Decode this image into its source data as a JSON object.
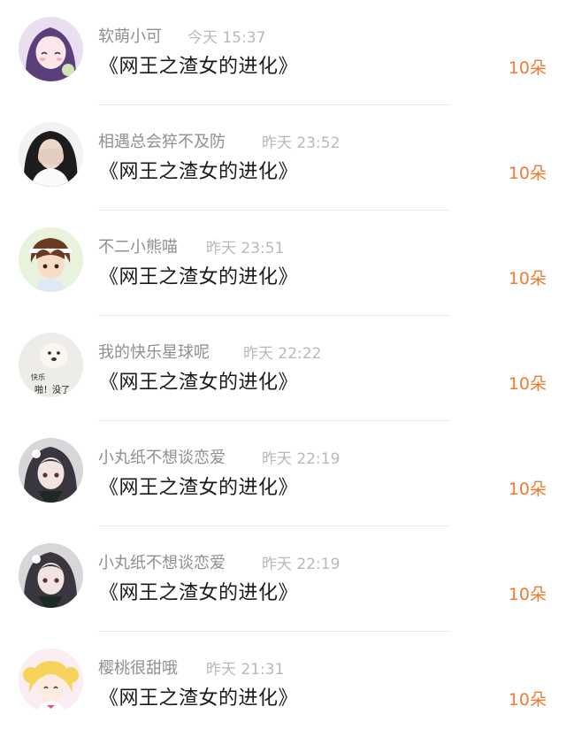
{
  "gifts": [
    {
      "user": "软萌小可",
      "time": "今天 15:37",
      "book": "《网王之渣女的进化》",
      "amount": "10朵",
      "avatar_icon": "anime-girl-purple-hair"
    },
    {
      "user": "相遇总会猝不及防",
      "time": "昨天 23:52",
      "book": "《网王之渣女的进化》",
      "amount": "10朵",
      "avatar_icon": "girl-covering-face"
    },
    {
      "user": "不二小熊喵",
      "time": "昨天 23:51",
      "book": "《网王之渣女的进化》",
      "amount": "10朵",
      "avatar_icon": "anime-boy-headband"
    },
    {
      "user": "我的快乐星球呢",
      "time": "昨天 22:22",
      "book": "《网王之渣女的进化》",
      "amount": "10朵",
      "avatar_icon": "dog-meme",
      "avatar_text": [
        "快乐",
        "啪！没了"
      ]
    },
    {
      "user": "小丸纸不想谈恋爱",
      "time": "昨天 22:19",
      "book": "《网王之渣女的进化》",
      "amount": "10朵",
      "avatar_icon": "anime-girl-dark-hair"
    },
    {
      "user": "小丸纸不想谈恋爱",
      "time": "昨天 22:19",
      "book": "《网王之渣女的进化》",
      "amount": "10朵",
      "avatar_icon": "anime-girl-dark-hair"
    },
    {
      "user": "樱桃很甜哦",
      "time": "昨天 21:31",
      "book": "《网王之渣女的进化》",
      "amount": "10朵",
      "avatar_icon": "sailor-moon"
    }
  ],
  "colors": {
    "amount": "#f07a30",
    "username": "#8f8f8f",
    "time": "#b9b9b9",
    "title": "#1a1a1a"
  }
}
